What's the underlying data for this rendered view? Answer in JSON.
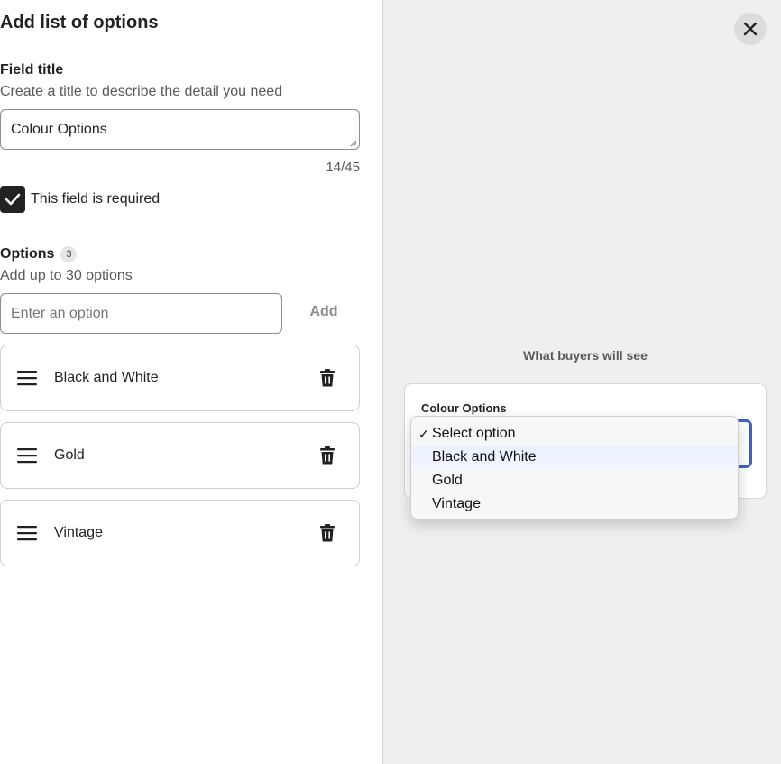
{
  "panel": {
    "title": "Add list of options",
    "field_title_label": "Field title",
    "field_title_help": "Create a title to describe the detail you need",
    "field_title_value": "Colour Options",
    "char_counter": "14/45",
    "required_label": "This field is required",
    "required_checked": true,
    "options_label": "Options",
    "options_count": "3",
    "options_help": "Add up to 30 options",
    "option_placeholder": "Enter an option",
    "add_label": "Add",
    "options": [
      {
        "label": "Black and White"
      },
      {
        "label": "Gold"
      },
      {
        "label": "Vintage"
      }
    ]
  },
  "preview": {
    "caption": "What buyers will see",
    "field_label": "Colour Options",
    "dropdown": {
      "check_mark": "✓",
      "selected": "Select option",
      "items": [
        "Select option",
        "Black and White",
        "Gold",
        "Vintage"
      ]
    }
  },
  "icons": {
    "close": "close-icon",
    "drag": "drag-handle-icon",
    "delete": "trash-icon",
    "checkbox": "checkmark-icon"
  },
  "colors": {
    "focus_ring": "#3b62c4",
    "preview_bg": "#efefef",
    "text_primary": "#222222",
    "text_secondary": "#595959"
  }
}
